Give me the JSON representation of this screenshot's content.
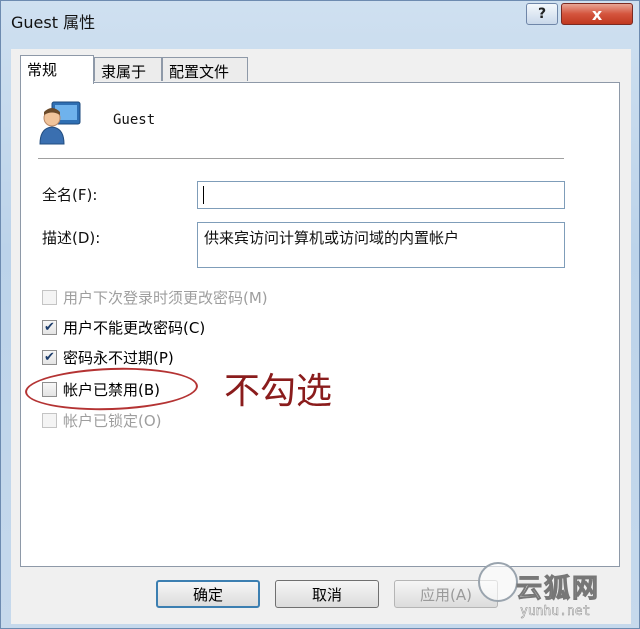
{
  "window": {
    "title": "Guest 属性",
    "help": "?",
    "close": "x"
  },
  "tabs": [
    {
      "label": "常规",
      "active": true
    },
    {
      "label": "隶属于",
      "active": false
    },
    {
      "label": "配置文件",
      "active": false
    }
  ],
  "user": {
    "icon": "user-icon",
    "name": "Guest"
  },
  "fields": {
    "fullname_label": "全名(F):",
    "fullname_value": "",
    "description_label": "描述(D):",
    "description_value": "供来宾访问计算机或访问域的内置帐户"
  },
  "checkboxes": [
    {
      "label": "用户下次登录时须更改密码(M)",
      "checked": false,
      "disabled": true
    },
    {
      "label": "用户不能更改密码(C)",
      "checked": true,
      "disabled": false
    },
    {
      "label": "密码永不过期(P)",
      "checked": true,
      "disabled": false
    },
    {
      "label": "帐户已禁用(B)",
      "checked": false,
      "disabled": false
    },
    {
      "label": "帐户已锁定(O)",
      "checked": false,
      "disabled": true
    }
  ],
  "annotation": {
    "text": "不勾选",
    "color": "#8a1c1c"
  },
  "buttons": {
    "ok": "确定",
    "cancel": "取消",
    "apply": "应用(A)"
  },
  "watermark": {
    "text": "云狐网",
    "url": "yunhu.net"
  }
}
